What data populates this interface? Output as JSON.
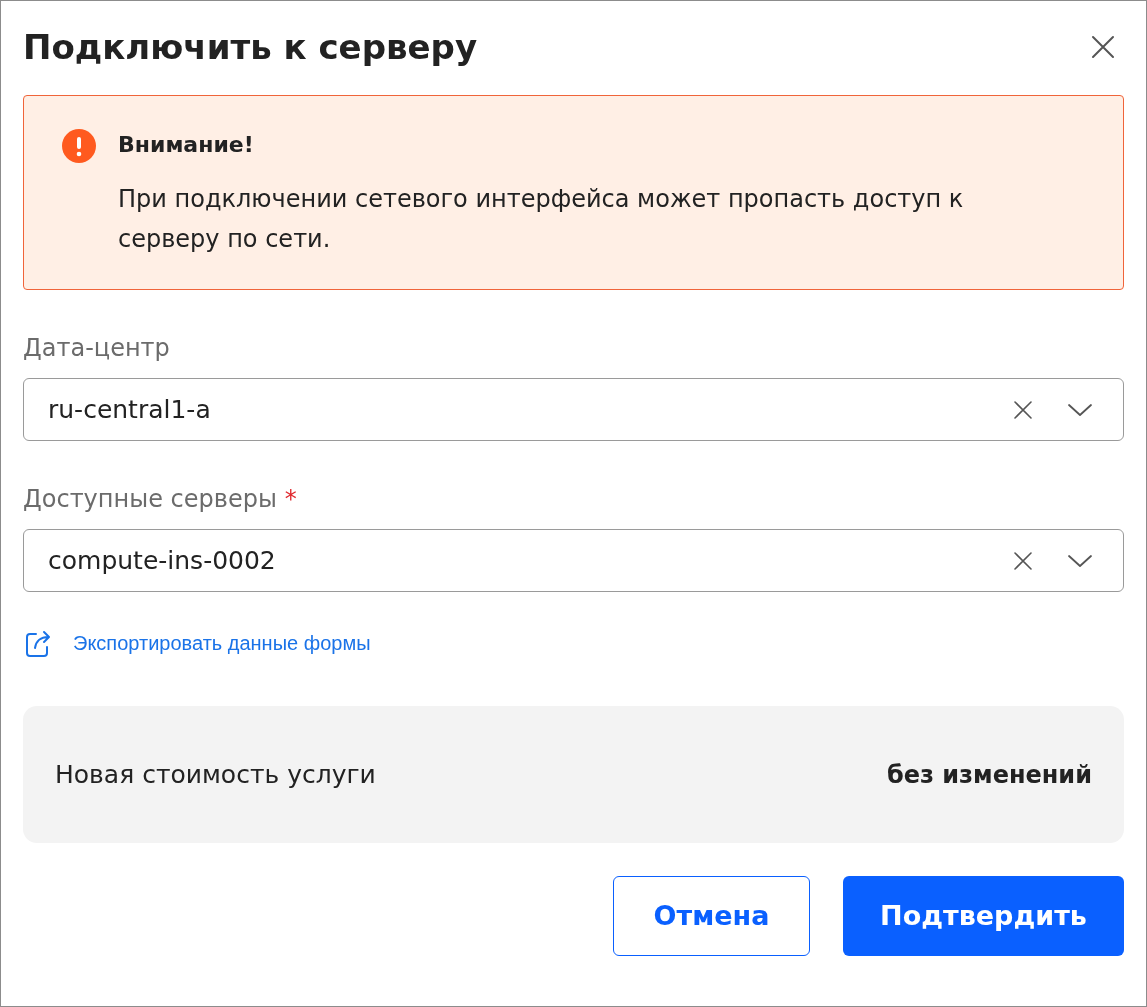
{
  "dialog": {
    "title": "Подключить к серверу"
  },
  "alert": {
    "title": "Внимание!",
    "text": "При подключении сетевого интерфейса может пропасть доступ к серверу по сети."
  },
  "fields": [
    {
      "label": "Дата-центр",
      "value": "ru-central1-a"
    },
    {
      "label": "Доступные серверы",
      "value": "compute-ins-0002",
      "required_mark": "*"
    }
  ],
  "export_link": "Экспортировать данные формы",
  "cost": {
    "label": "Новая стоимость услуги",
    "value": "без изменений"
  },
  "buttons": [
    {
      "label": "Отмена",
      "kind": "secondary"
    },
    {
      "label": "Подтвердить",
      "kind": "primary"
    }
  ]
}
